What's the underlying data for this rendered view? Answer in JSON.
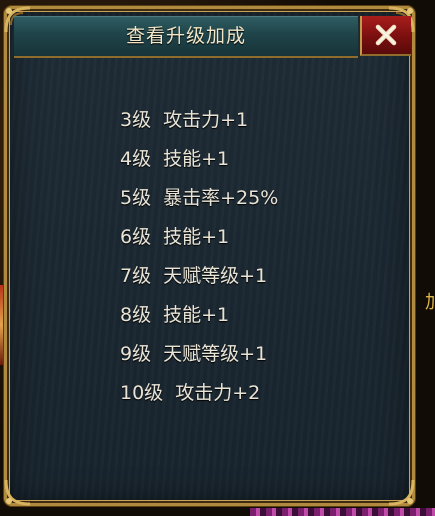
{
  "dialog": {
    "title": "查看升级加成",
    "close_icon": "close-x-icon",
    "colors": {
      "frame_gold": "#b08a3e",
      "panel_bg": "#1a2731",
      "title_bar": "#1f4449",
      "close_red": "#8a1414",
      "text": "#e9e4d6"
    }
  },
  "bonuses": [
    {
      "level": "3级",
      "effect": "攻击力+1"
    },
    {
      "level": "4级",
      "effect": "技能+1"
    },
    {
      "level": "5级",
      "effect": "暴击率+25%"
    },
    {
      "level": "6级",
      "effect": "技能+1"
    },
    {
      "level": "7级",
      "effect": "天赋等级+1"
    },
    {
      "level": "8级",
      "effect": "技能+1"
    },
    {
      "level": "9级",
      "effect": "天赋等级+1"
    },
    {
      "level": "10级",
      "effect": "攻击力+2"
    }
  ],
  "background": {
    "right_edge_glyph": "加"
  }
}
